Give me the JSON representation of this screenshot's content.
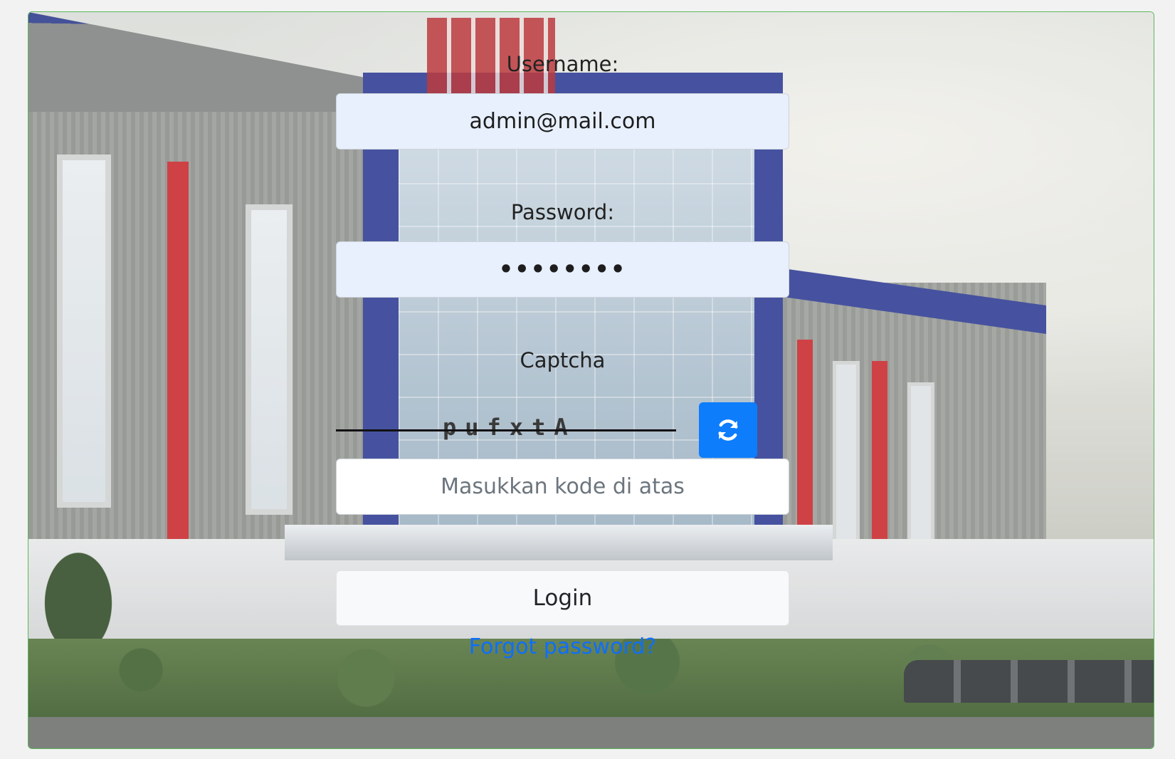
{
  "form": {
    "username_label": "Username:",
    "username_value": "admin@mail.com",
    "password_label": "Password:",
    "password_value": "••••••••",
    "captcha_label": "Captcha",
    "captcha_code": "pufxtA",
    "captcha_placeholder": "Masukkan kode di atas",
    "refresh_icon": "refresh-icon",
    "login_label": "Login",
    "forgot_label": "Forgot password?"
  },
  "colors": {
    "frame_border": "#5cb85c",
    "filled_input_bg": "#e8f0fe",
    "refresh_button": "#0d7dfc",
    "link": "#0d6efd"
  }
}
